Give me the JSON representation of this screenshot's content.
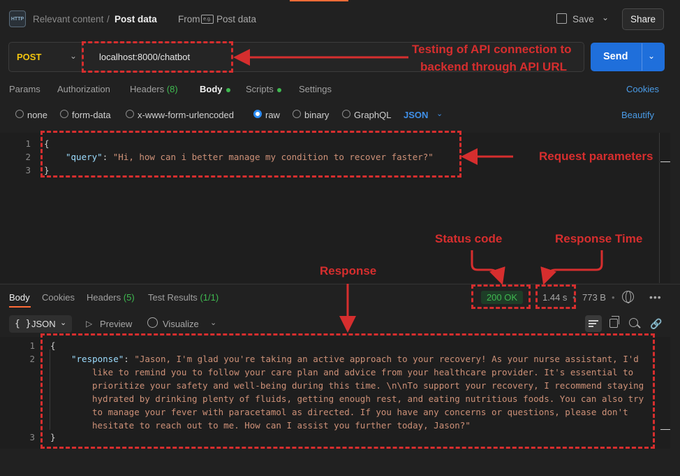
{
  "header": {
    "breadcrumb_parent": "Relevant content",
    "breadcrumb_sep": "/",
    "breadcrumb_current": "Post data",
    "from_label": "From",
    "from_name": "Post data",
    "save_label": "Save",
    "share_label": "Share"
  },
  "request": {
    "method": "POST",
    "url": "localhost:8000/chatbot",
    "send_label": "Send"
  },
  "tabs": {
    "params": "Params",
    "authorization": "Authorization",
    "headers": "Headers",
    "headers_count": "(8)",
    "body": "Body",
    "scripts": "Scripts",
    "settings": "Settings",
    "cookies": "Cookies"
  },
  "body_types": {
    "none": "none",
    "form_data": "form-data",
    "urlencoded": "x-www-form-urlencoded",
    "raw": "raw",
    "binary": "binary",
    "graphql": "GraphQL",
    "format": "JSON",
    "selected": "raw",
    "beautify": "Beautify"
  },
  "request_body": {
    "line_numbers": [
      "1",
      "2",
      "3"
    ],
    "open": "{",
    "key": "\"query\"",
    "colon": ": ",
    "value": "\"Hi, how can i better manage my condition to recover faster?\"",
    "close": "}"
  },
  "response": {
    "tabs": {
      "body": "Body",
      "cookies": "Cookies",
      "headers": "Headers",
      "headers_count": "(5)",
      "test_results": "Test Results",
      "test_count": "(1/1)"
    },
    "status": "200 OK",
    "time": "1.44 s",
    "size": "773 B",
    "format": "JSON",
    "format_braces": "{ }",
    "preview": "Preview",
    "visualize": "Visualize",
    "line_numbers": [
      "1",
      "2",
      "3"
    ],
    "open": "{",
    "key": "\"response\"",
    "colon": ": ",
    "value_lines": [
      "\"Jason, I'm glad you're taking an active approach to your recovery! As your nurse assistant, I'd",
      "like to remind you to follow your care plan and advice from your healthcare provider. It's essential to",
      "prioritize your safety and well-being during this time. \\n\\nTo support your recovery, I recommend staying",
      "hydrated by drinking plenty of fluids, getting enough rest, and eating nutritious foods. You can also try",
      "to manage your fever with paracetamol as directed. If you have any concerns or questions, please don't",
      "hesitate to reach out to me. How can I assist you further today, Jason?\""
    ],
    "close": "}"
  },
  "annotations": {
    "api_url_line1": "Testing of API connection to",
    "api_url_line2": "backend through API URL",
    "request_params": "Request parameters",
    "status_code": "Status code",
    "response_time": "Response Time",
    "response": "Response"
  },
  "icons": {
    "http": "HTTP",
    "from": "e.g."
  },
  "colors": {
    "accent": "#ff6c37",
    "send": "#1f6fdb",
    "annotation": "#d62e2e",
    "status_ok": "#3fb950",
    "method": "#f1c40f"
  }
}
